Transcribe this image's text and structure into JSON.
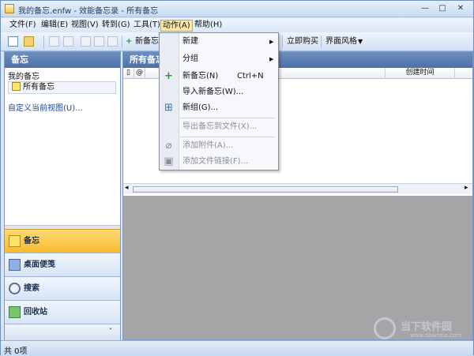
{
  "window": {
    "title": "我的备忘.enfw - 效能备忘录 - 所有备忘"
  },
  "menubar": {
    "items": [
      {
        "label": "文件(F)"
      },
      {
        "label": "编辑(E)"
      },
      {
        "label": "视图(V)"
      },
      {
        "label": "转到(G)"
      },
      {
        "label": "工具(T)"
      },
      {
        "label": "动作(A)"
      },
      {
        "label": "帮助(H)"
      }
    ]
  },
  "toolbar": {
    "new_memo": "新备忘",
    "buy_now": "立即购买",
    "ui_style": "界面风格"
  },
  "left_pane": {
    "title": "备忘",
    "tree_root": "我的备忘",
    "tree_item": "所有备忘",
    "custom_view": "自定义当前视图(U)...",
    "nav": [
      {
        "label": "备忘"
      },
      {
        "label": "桌面便笺"
      },
      {
        "label": "搜索"
      },
      {
        "label": "回收站"
      }
    ]
  },
  "main_pane": {
    "title": "所有备忘",
    "columns": {
      "created_time": "创建时间"
    }
  },
  "status": {
    "text": "共 0项"
  },
  "dropdown": {
    "items": [
      {
        "label": "新建",
        "icon": "none"
      },
      {
        "label": "分组",
        "icon": "none"
      },
      {
        "label": "新备忘(N)",
        "shortcut": "Ctrl+N",
        "icon": "plus-icon"
      },
      {
        "label": "导入新备忘(W)...",
        "icon": "none"
      },
      {
        "label": "新组(G)...",
        "icon": "group-icon"
      },
      {
        "label": "导出备忘到文件(X)...",
        "icon": "none"
      },
      {
        "label": "添加附件(A)...",
        "icon": "paperclip-icon"
      },
      {
        "label": "添加文件链接(F)...",
        "icon": "file-link-icon"
      }
    ]
  },
  "watermark": {
    "text": "当下软件园",
    "sub": "www.downxia.com"
  },
  "colors": {
    "accent": "#ffd35a",
    "header": "#5a7fb5",
    "status": "#d7e6f8"
  }
}
